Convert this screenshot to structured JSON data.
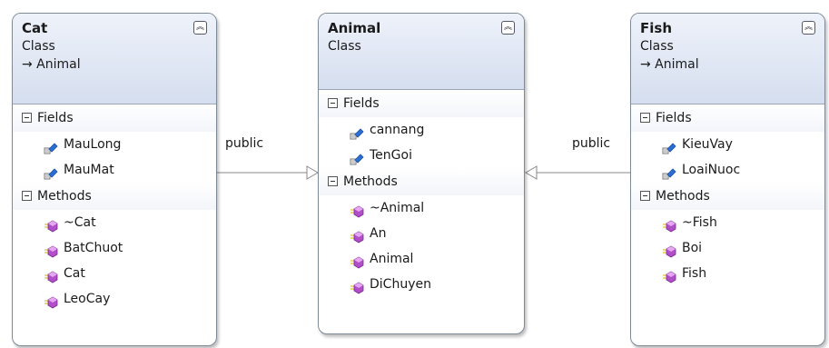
{
  "classes": {
    "cat": {
      "name": "Cat",
      "kind": "Class",
      "inherits": "→ Animal",
      "fields_label": "Fields",
      "methods_label": "Methods",
      "fields": [
        "MauLong",
        "MauMat"
      ],
      "methods": [
        "~Cat",
        "BatChuot",
        "Cat",
        "LeoCay"
      ]
    },
    "animal": {
      "name": "Animal",
      "kind": "Class",
      "fields_label": "Fields",
      "methods_label": "Methods",
      "fields": [
        "cannang",
        "TenGoi"
      ],
      "methods": [
        "~Animal",
        "An",
        "Animal",
        "DiChuyen"
      ]
    },
    "fish": {
      "name": "Fish",
      "kind": "Class",
      "inherits": "→ Animal",
      "fields_label": "Fields",
      "methods_label": "Methods",
      "fields": [
        "KieuVay",
        "LoaiNuoc"
      ],
      "methods": [
        "~Fish",
        "Boi",
        "Fish"
      ]
    }
  },
  "connectors": {
    "cat_to_animal": "public",
    "fish_to_animal": "public"
  },
  "icons": {
    "collapse": "double-chevron-up-icon",
    "field": "field-icon",
    "method": "method-icon",
    "section": "minus-box-icon"
  },
  "colors": {
    "header_top": "#eef2fa",
    "header_bottom": "#d5deef",
    "border": "#7f8a99",
    "field_icon": "#2a6fd6",
    "method_icon": "#b04fc8"
  }
}
